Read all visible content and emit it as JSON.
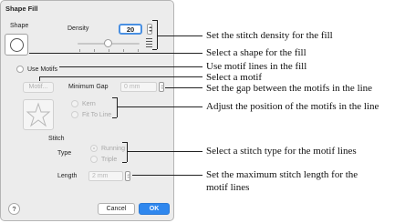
{
  "dialog": {
    "title": "Shape Fill",
    "shape_label": "Shape",
    "density_label": "Density",
    "density_value": "20",
    "use_motifs_label": "Use Motifs",
    "use_motifs_checked": false,
    "motif_button_label": "Motif...",
    "minimum_gap_label": "Minimum Gap",
    "minimum_gap_value": "0 mm",
    "kern_label": "Kern",
    "fit_to_line_label": "Fit To Line",
    "stitch_section_label": "Stitch",
    "type_label": "Type",
    "running_label": "Running",
    "triple_label": "Triple",
    "length_label": "Length",
    "length_value": "2 mm",
    "help_label": "?",
    "cancel_label": "Cancel",
    "ok_label": "OK"
  },
  "callouts": {
    "density": "Set the stitch density for the fill",
    "shape": "Select a shape for the fill",
    "use_motifs": "Use motif lines in the fill",
    "motif": "Select a motif",
    "gap": "Set the gap between the motifs in the line",
    "adjust": "Adjust the position of the motifs in the line",
    "stitch_type": "Select a stitch type for the motif lines",
    "length_line1": "Set the maximum stitch length for the",
    "length_line2": "motif lines"
  },
  "colors": {
    "accent": "#2f87ee",
    "dialog_bg": "#ececec",
    "disabled_text": "#a9a9a9"
  },
  "icons": [
    "circle-shape-icon",
    "star-motif-icon",
    "density-lines-icon",
    "stepper-icon",
    "help-icon"
  ]
}
